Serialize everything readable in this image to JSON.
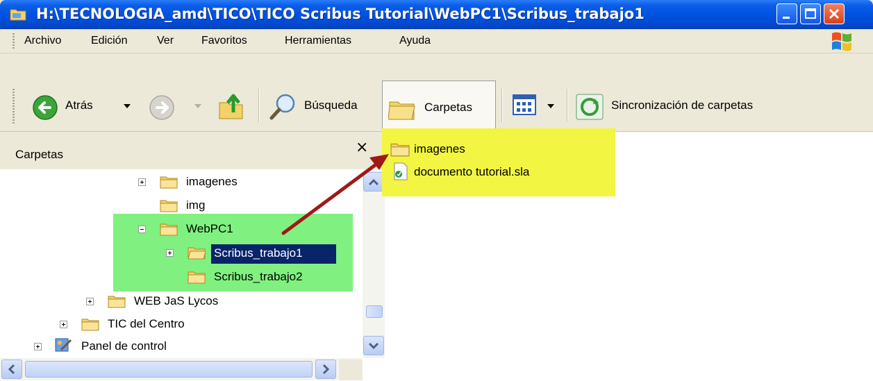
{
  "window": {
    "title": "H:\\TECNOLOGIA_amd\\TICO\\TICO Scribus Tutorial\\WebPC1\\Scribus_trabajo1"
  },
  "menu": [
    "Archivo",
    "Edición",
    "Ver",
    "Favoritos",
    "Herramientas",
    "Ayuda"
  ],
  "toolbar": {
    "back": "Atrás",
    "search": "Búsqueda",
    "folders": "Carpetas",
    "sync": "Sincronización de carpetas"
  },
  "folders_pane": {
    "title": "Carpetas",
    "close": "×",
    "tree": [
      {
        "label": "imagenes",
        "expander": "plus"
      },
      {
        "label": "img",
        "expander": "none"
      },
      {
        "label": "WebPC1",
        "expander": "minus"
      },
      {
        "label": "Scribus_trabajo1",
        "expander": "plus",
        "selected": true
      },
      {
        "label": "Scribus_trabajo2",
        "expander": "none"
      },
      {
        "label": "WEB JaS Lycos",
        "expander": "plus"
      },
      {
        "label": "TIC del Centro",
        "expander": "plus"
      },
      {
        "label": "Panel de control",
        "expander": "plus"
      }
    ]
  },
  "files": [
    {
      "name": "imagenes",
      "type": "folder"
    },
    {
      "name": "documento tutorial.sla",
      "type": "scribus-document"
    }
  ],
  "colors": {
    "titlebar": "#0052e0",
    "green_highlight": "#80f080",
    "yellow_highlight": "#f2f542",
    "selection": "#0a246a",
    "arrow": "#a01818"
  }
}
